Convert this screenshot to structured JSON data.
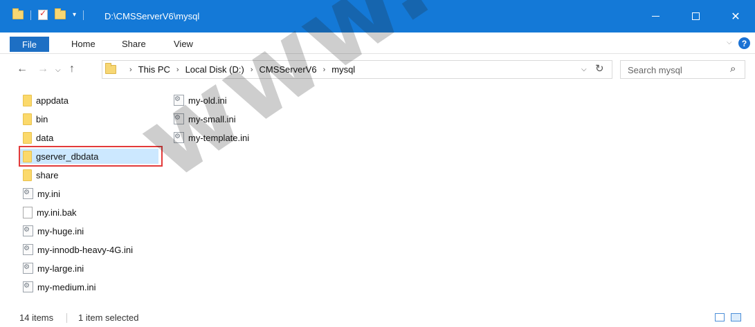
{
  "window": {
    "path_title": "D:\\CMSServerV6\\mysql",
    "minimize_icon": "minimize-icon",
    "maximize_icon": "maximize-icon",
    "close_icon": "close-icon",
    "close_glyph": "✕"
  },
  "ribbon": {
    "tabs": [
      "File",
      "Home",
      "Share",
      "View"
    ],
    "help_glyph": "?"
  },
  "address": {
    "crumbs": [
      "This PC",
      "Local Disk (D:)",
      "CMSServerV6",
      "mysql"
    ],
    "search_placeholder": "Search mysql"
  },
  "files": {
    "column1": [
      {
        "name": "appdata",
        "type": "folder"
      },
      {
        "name": "bin",
        "type": "folder"
      },
      {
        "name": "data",
        "type": "folder"
      },
      {
        "name": "gserver_dbdata",
        "type": "folder",
        "selected": true
      },
      {
        "name": "share",
        "type": "folder"
      },
      {
        "name": "my.ini",
        "type": "config"
      },
      {
        "name": "my.ini.bak",
        "type": "file"
      },
      {
        "name": "my-huge.ini",
        "type": "config"
      },
      {
        "name": "my-innodb-heavy-4G.ini",
        "type": "config"
      },
      {
        "name": "my-large.ini",
        "type": "config"
      },
      {
        "name": "my-medium.ini",
        "type": "config"
      }
    ],
    "column2": [
      {
        "name": "my-old.ini",
        "type": "config"
      },
      {
        "name": "my-small.ini",
        "type": "config"
      },
      {
        "name": "my-template.ini",
        "type": "config"
      }
    ]
  },
  "status": {
    "item_count": "14 items",
    "selection": "1 item selected"
  },
  "colors": {
    "titlebar": "#1479d7",
    "file_tab": "#1d6fc4",
    "selection": "#cce8ff",
    "highlight_box": "#e23a3a"
  },
  "watermark": "www.bezpe"
}
